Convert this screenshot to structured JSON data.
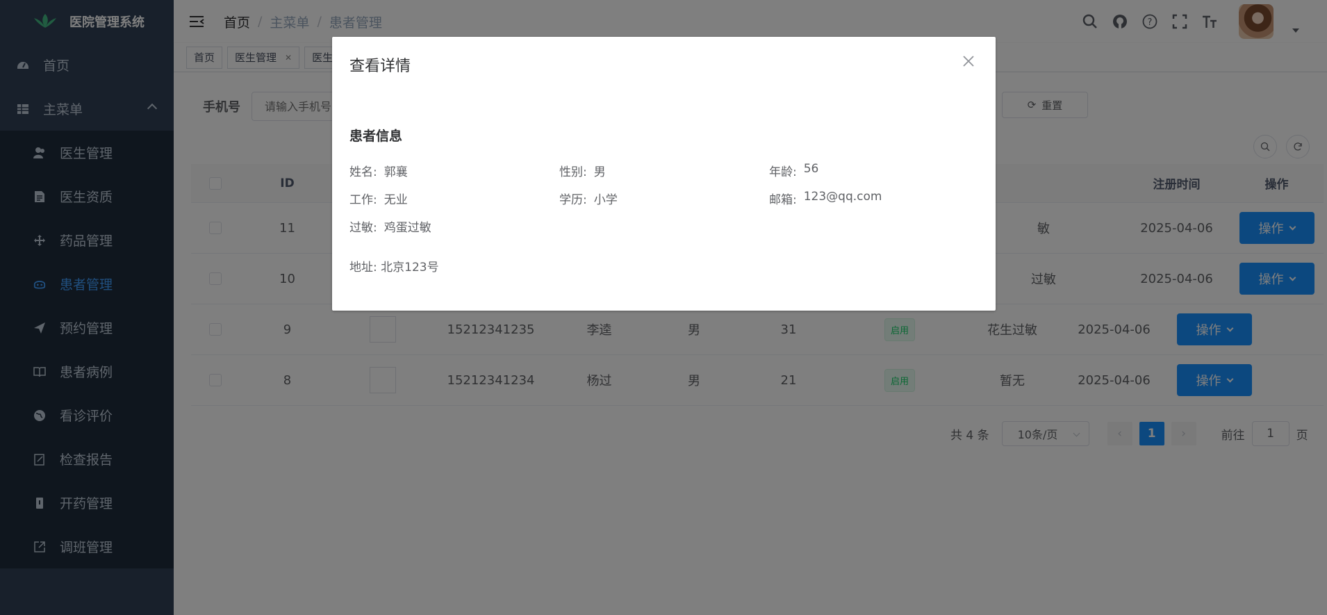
{
  "app": {
    "title": "医院管理系统"
  },
  "sidebar": {
    "home": "首页",
    "main_menu": "主菜单",
    "items": [
      {
        "label": "医生管理",
        "icon": "user-group-icon"
      },
      {
        "label": "医生资质",
        "icon": "document-icon"
      },
      {
        "label": "药品管理",
        "icon": "move-icon"
      },
      {
        "label": "患者管理",
        "icon": "patient-icon",
        "active": true
      },
      {
        "label": "预约管理",
        "icon": "send-icon"
      },
      {
        "label": "患者病例",
        "icon": "book-icon"
      },
      {
        "label": "看诊评价",
        "icon": "globe-icon"
      },
      {
        "label": "检查报告",
        "icon": "edit-icon"
      },
      {
        "label": "开药管理",
        "icon": "pill-icon"
      },
      {
        "label": "调班管理",
        "icon": "external-link-icon"
      }
    ]
  },
  "breadcrumb": [
    "首页",
    "主菜单",
    "患者管理"
  ],
  "tags": [
    {
      "label": "首页",
      "closable": false
    },
    {
      "label": "医生管理",
      "closable": true
    },
    {
      "label": "医生",
      "closable": false
    }
  ],
  "search": {
    "label": "手机号",
    "placeholder": "请输入手机号",
    "reset": "重置"
  },
  "table": {
    "headers": {
      "id": "ID",
      "register_time": "注册时间",
      "op": "操作"
    },
    "op_label": "操作",
    "rows": [
      {
        "id": "11",
        "phone": "",
        "name": "",
        "gender": "",
        "age": "",
        "status": "",
        "allergy": "敏",
        "date": "2025-04-06"
      },
      {
        "id": "10",
        "phone": "",
        "name": "",
        "gender": "",
        "age": "",
        "status": "",
        "allergy": "过敏",
        "date": "2025-04-06"
      },
      {
        "id": "9",
        "phone": "15212341235",
        "name": "李逵",
        "gender": "男",
        "age": "31",
        "status": "启用",
        "allergy": "花生过敏",
        "date": "2025-04-06"
      },
      {
        "id": "8",
        "phone": "15212341234",
        "name": "杨过",
        "gender": "男",
        "age": "21",
        "status": "启用",
        "allergy": "暂无",
        "date": "2025-04-06"
      }
    ]
  },
  "pagination": {
    "total": "共 4 条",
    "page_size": "10条/页",
    "current": "1",
    "goto_prefix": "前往",
    "goto_value": "1",
    "goto_suffix": "页"
  },
  "dialog": {
    "title": "查看详情",
    "section": "患者信息",
    "fields": {
      "name": {
        "k": "姓名:",
        "v": "郭襄"
      },
      "gender": {
        "k": "性别:",
        "v": "男"
      },
      "age": {
        "k": "年龄:",
        "v": "56"
      },
      "job": {
        "k": "工作:",
        "v": "无业"
      },
      "edu": {
        "k": "学历:",
        "v": "小学"
      },
      "email": {
        "k": "邮箱:",
        "v": "123@qq.com"
      },
      "allergy": {
        "k": "过敏:",
        "v": "鸡蛋过敏"
      }
    },
    "address": "地址: 北京123号"
  },
  "colors": {
    "sidebar_bg": "#304156",
    "submenu_bg": "#1f2d3d",
    "primary": "#1890ff",
    "active_menu": "#409eff"
  }
}
